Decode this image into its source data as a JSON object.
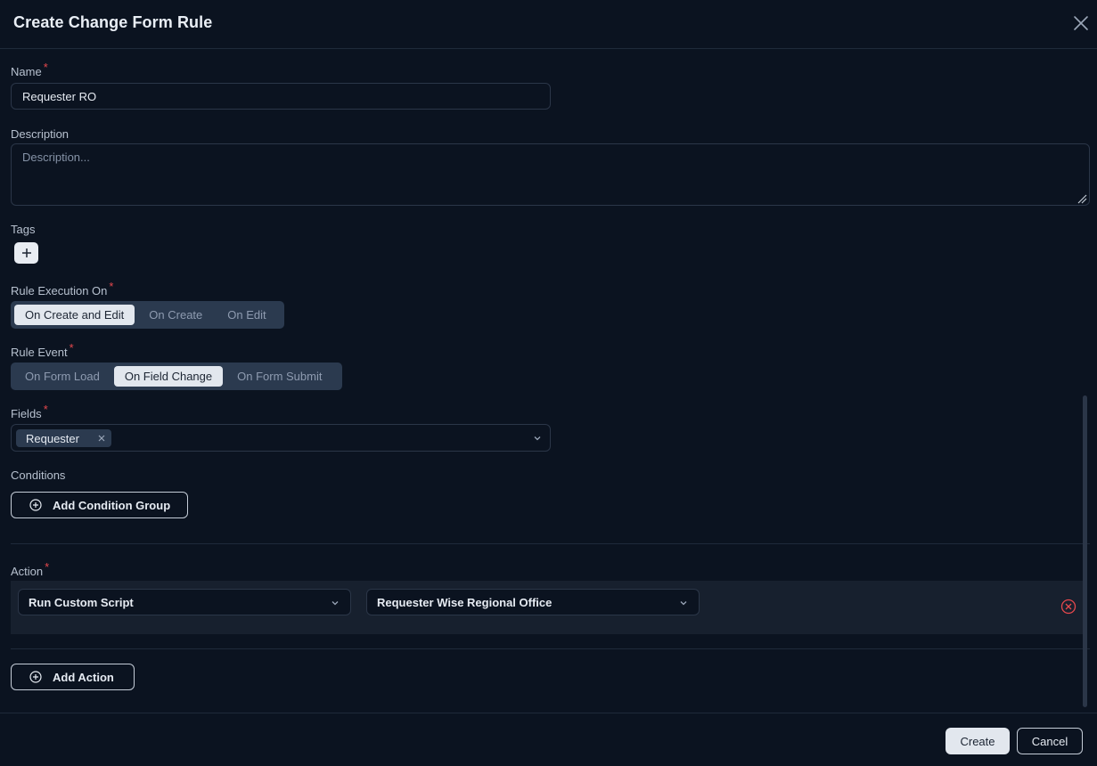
{
  "dialog": {
    "title": "Create Change Form Rule"
  },
  "colors": {
    "required": "#e5484d",
    "remove": "#e5484d"
  },
  "form": {
    "name": {
      "label": "Name",
      "required_mark": "*",
      "value": "Requester RO"
    },
    "description": {
      "label": "Description",
      "placeholder": "Description..."
    },
    "tags": {
      "label": "Tags",
      "add_icon": "plus-icon"
    },
    "rule_execution": {
      "label": "Rule Execution On",
      "required_mark": "*",
      "options": [
        "On Create and Edit",
        "On Create",
        "On Edit"
      ],
      "selected": "On Create and Edit"
    },
    "rule_event": {
      "label": "Rule Event",
      "required_mark": "*",
      "options": [
        "On Form Load",
        "On Field Change",
        "On Form Submit"
      ],
      "selected": "On Field Change"
    },
    "fields": {
      "label": "Fields",
      "required_mark": "*",
      "chips": [
        "Requester"
      ]
    },
    "conditions": {
      "label": "Conditions",
      "add_group_label": "Add Condition Group"
    },
    "action": {
      "label": "Action",
      "required_mark": "*",
      "type_value": "Run Custom Script",
      "script_value": "Requester Wise Regional Office",
      "add_action_label": "Add Action"
    }
  },
  "footer": {
    "create_label": "Create",
    "cancel_label": "Cancel"
  }
}
